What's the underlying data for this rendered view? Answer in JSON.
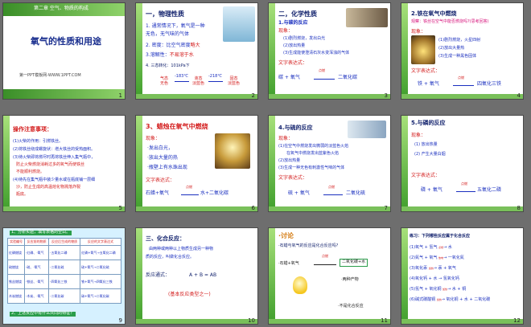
{
  "slides": [
    {
      "number": "1",
      "chapter": "第二章 空气、物质的构成",
      "title": "氧气的性质和用途",
      "footer": "第一PPT模板网-WWW.1PPT.COM"
    },
    {
      "number": "2",
      "heading": "一，物理性质",
      "l1a": "1. 通常情况下，氧气是一种",
      "l1b": "无色，无气味的气体",
      "l2a": "2. 密度：",
      "l2b": "比空气密度",
      "l2c": "略大",
      "l3a": "3.溶解性：",
      "l3b": "不易溶于水",
      "l4": "4. 三态转化：101kPa下",
      "s1": "气态",
      "s1b": "无色",
      "arrow1": "-183℃",
      "s2": "液态",
      "s2b": "淡蓝色",
      "arrow2": "-218℃",
      "s3": "固态",
      "s3b": "淡蓝色"
    },
    {
      "number": "3",
      "heading": "二，化学性质",
      "sub": "1.与碳的反应",
      "obs": "现象：",
      "o1": "(1)剧烈燃烧，发出白光",
      "o2": "(2)放出热量",
      "o3": "(3)生成能使澄清石灰水变浑浊的气体",
      "eqlabel": "文字表达式：",
      "eq": "碳 + 氧气",
      "cond": "点燃",
      "prod": "二氧化碳"
    },
    {
      "number": "4",
      "heading": "2.铁在氧气中燃烧",
      "obs": "观察：铁丝在空气中能否燃烧吗?(思考回答)",
      "sub": "现象：",
      "o1": "(1)剧烈燃烧，火星四射",
      "o2": "(2)放出大量热",
      "o3": "(3)生成一种黑色固体",
      "eqlabel": "文字表达式：",
      "eq": "铁 + 氧气",
      "cond": "点燃",
      "prod": "四氧化三铁"
    },
    {
      "number": "5",
      "heading": "操作注意事项：",
      "p1": "(1)火柴的作用：引燃铁丝。",
      "p2": "(2)将铁丝绕成螺旋状：增大铁丝的受热面积。",
      "p3": "(3)待火柴即将燃尽时再将铁丝伸入集气瓶中，",
      "p3b": "防止火柴燃烧消耗过多的氧气而使铁丝",
      "p3c": "不能顺利燃烧。",
      "p4": "(4)待先在集气瓶中装少量水或在瓶底铺一层细",
      "p4b": "沙，防止生成的高温熔化物溅落炸裂",
      "p4c": "瓶底。"
    },
    {
      "number": "6",
      "heading": "3、蜡烛在氧气中燃烧",
      "obs": "现象：",
      "o1": "·发出白光，",
      "o2": "·放出大量的热",
      "o3": "·瓶壁上有水珠出现",
      "eqlabel": "文字表达式：",
      "eq": "石蜡+氧气",
      "cond": "点燃",
      "prod": "水+二氧化碳"
    },
    {
      "number": "7",
      "heading": "4.与硫的反应",
      "obs": "现象：",
      "o1": "(1)在空气中燃烧发出微弱的淡蓝色火焰",
      "o1b": "在氧气中燃烧发出蓝紫色火焰",
      "o2": "(2)放出热量",
      "o3": "(3)生成一种无色有刺激性气味的气体",
      "eqlabel": "文字表达式：",
      "eq": "硫 + 氧气",
      "cond": "点燃",
      "prod": "二氧化硫"
    },
    {
      "number": "8",
      "heading": "5.与磷的反应",
      "obs": "现象：",
      "o1": "(1) 放出热量",
      "o2": "(2) 产生大量白烟",
      "eqlabel": "文字表达式：",
      "eq": "磷 + 氧气",
      "cond": "点燃",
      "prod": "五氧化二磷"
    },
    {
      "number": "9",
      "q1": "1、分析实验，填写表格的空白。",
      "headers": [
        "实验编号",
        "反应前的物质",
        "反应后生成的物质",
        "反应的文字表达式"
      ],
      "rows": [
        [
          "红磷燃烧",
          "·红磷、·氧气",
          "·五氧化二磷",
          "红磷+氧气→五氧化二磷"
        ],
        [
          "硫燃烧",
          "·硫、·氧气",
          "·二氧化硫",
          "硫+氧气→二氧化硫"
        ],
        [
          "铁丝燃烧",
          "·铁丝、·氧气",
          "·四氧化三铁",
          "铁+氧气→四氧化三铁"
        ],
        [
          "木炭燃烧",
          "·木炭、·氧气",
          "·二氧化碳",
          "碳+氧气→二氧化碳"
        ]
      ],
      "q2": "2、上述反应中有什么共同的特征？"
    },
    {
      "number": "10",
      "heading": "三、化合反应：",
      "d1": "由两种或两种以上物质生成另一种物",
      "d2": "质的反应，叫做化合反应。",
      "formula": "反应通式：",
      "expr": "A + B = AB",
      "note": "(基本反应类型之一)"
    },
    {
      "number": "11",
      "heading": "·讨论",
      "q": "·石蜡与氧气的反应是化合反应吗?",
      "left": "·石蜡+氧气",
      "cond": "点燃",
      "right": "二氧化碳+水",
      "mid": "·两种产物",
      "conclusion": "·不是化合反应"
    },
    {
      "number": "12",
      "heading": "练习：下列哪些反应属于化合反应",
      "e1": "(1)氧气 + 氢气",
      "e1p": "水",
      "e2": "(2)氮气 + 氧气",
      "e2p": "一氧化氮",
      "e3": "(3)氧化汞",
      "e3p": "汞 + 氧气",
      "e4": "(4)氧化钙 + 水",
      "e4p": "氢氧化钙",
      "e5": "(5)氢气 + 氧化铜",
      "e5p": "水 + 铜",
      "e6": "(6)碱式碳酸铜",
      "e6p": "氧化铜 + 水 + 二氧化碳",
      "c1": "点燃",
      "c2": "放电",
      "c3": "加热",
      "c5": "加热",
      "c6": "加热"
    }
  ]
}
